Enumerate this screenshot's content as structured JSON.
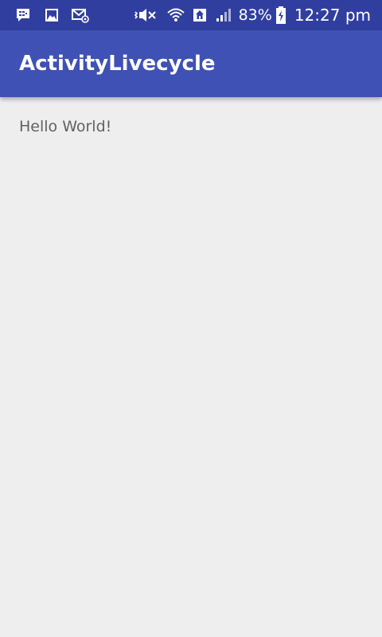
{
  "status_bar": {
    "battery_percent": "83%",
    "time": "12:27 pm",
    "background_color": "#303f9f",
    "icons_left": [
      "bbm-chat-icon",
      "gallery-image-icon",
      "email-icon"
    ],
    "icons_right": [
      "vibrate-icon",
      "wifi-icon",
      "home-signal-icon",
      "cell-signal-icon",
      "battery-charging-icon"
    ]
  },
  "app_bar": {
    "title": "ActivityLivecycle",
    "background_color": "#3f51b5"
  },
  "content": {
    "text": "Hello World!"
  },
  "background_color": "#eeeeee"
}
